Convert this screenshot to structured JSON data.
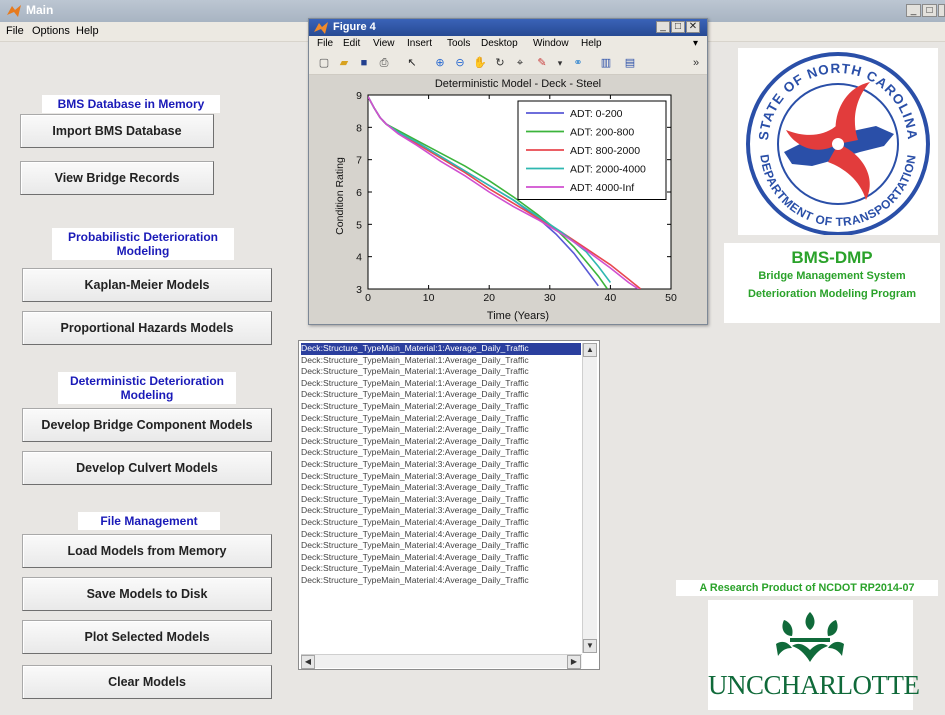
{
  "main_window": {
    "title": "Main",
    "menu": [
      "File",
      "Options",
      "Help"
    ]
  },
  "left_panel": {
    "bms_database_label": "BMS Database in Memory",
    "import_button": "Import BMS Database",
    "view_records_button": "View Bridge Records",
    "probabilistic_label_line1": "Probabilistic Deterioration",
    "probabilistic_label_line2": "Modeling",
    "kaplan_meier_button": "Kaplan-Meier Models",
    "proportional_hazards_button": "Proportional Hazards Models",
    "deterministic_label_line1": "Deterministic Deterioration",
    "deterministic_label_line2": "Modeling",
    "bridge_component_button": "Develop Bridge Component Models",
    "culvert_button": "Develop Culvert Models",
    "file_management_label": "File Management",
    "load_button": "Load Models from Memory",
    "save_button": "Save Models to Disk",
    "plot_button": "Plot Selected Models",
    "clear_button": "Clear Models"
  },
  "figure_window": {
    "title": "Figure 4",
    "menu": [
      "File",
      "Edit",
      "View",
      "Insert",
      "Tools",
      "Desktop",
      "Window",
      "Help"
    ],
    "toolbar_icons": [
      "new-file-icon",
      "open-folder-icon",
      "save-icon",
      "print-icon",
      "pointer-icon",
      "zoom-in-icon",
      "zoom-out-icon",
      "pan-icon",
      "rotate-icon",
      "data-cursor-icon",
      "brush-icon",
      "link-icon",
      "colorbar-icon",
      "legend-icon"
    ]
  },
  "chart_data": {
    "type": "line",
    "title": "Deterministic Model - Deck - Steel",
    "xlabel": "Time (Years)",
    "ylabel": "Condition Rating",
    "xlim": [
      0,
      50
    ],
    "ylim": [
      3,
      9
    ],
    "xticks": [
      0,
      10,
      20,
      30,
      40,
      50
    ],
    "yticks": [
      3,
      4,
      5,
      6,
      7,
      8,
      9
    ],
    "grid": false,
    "legend_position": "top-right",
    "series": [
      {
        "name": "ADT: 0-200",
        "color": "#5a5ad6",
        "x": [
          0,
          1,
          2,
          3,
          5,
          8,
          12,
          16,
          20,
          24,
          28,
          31,
          34,
          36,
          38
        ],
        "y": [
          8.95,
          8.6,
          8.3,
          8.1,
          7.85,
          7.55,
          7.1,
          6.65,
          6.2,
          5.75,
          5.2,
          4.7,
          4.1,
          3.6,
          3.1
        ]
      },
      {
        "name": "ADT: 200-800",
        "color": "#3cb43c",
        "x": [
          0,
          1,
          2,
          3,
          5,
          8,
          12,
          16,
          20,
          24,
          28,
          31,
          34,
          36,
          38,
          39.5
        ],
        "y": [
          8.95,
          8.6,
          8.3,
          8.1,
          7.9,
          7.6,
          7.2,
          6.8,
          6.35,
          5.85,
          5.3,
          4.85,
          4.3,
          3.85,
          3.4,
          3.0
        ]
      },
      {
        "name": "ADT: 800-2000",
        "color": "#e8484f",
        "x": [
          0,
          1,
          2,
          3,
          5,
          8,
          12,
          16,
          20,
          24,
          28,
          32,
          36,
          40,
          43,
          45
        ],
        "y": [
          8.95,
          8.6,
          8.3,
          8.1,
          7.85,
          7.5,
          7.05,
          6.6,
          6.1,
          5.65,
          5.2,
          4.75,
          4.25,
          3.75,
          3.3,
          3.0
        ]
      },
      {
        "name": "ADT: 2000-4000",
        "color": "#2fb8b0",
        "x": [
          0,
          1,
          2,
          3,
          5,
          8,
          12,
          16,
          20,
          24,
          28,
          32,
          36,
          38,
          40
        ],
        "y": [
          8.95,
          8.6,
          8.3,
          8.1,
          7.85,
          7.55,
          7.1,
          6.65,
          6.2,
          5.75,
          5.25,
          4.75,
          4.15,
          3.7,
          3.2
        ]
      },
      {
        "name": "ADT: 4000-Inf",
        "color": "#d04fd0",
        "x": [
          0,
          1,
          2,
          3,
          5,
          8,
          12,
          16,
          20,
          24,
          28,
          32,
          36,
          40,
          43,
          45
        ],
        "y": [
          8.95,
          8.6,
          8.3,
          8.1,
          7.8,
          7.45,
          6.95,
          6.5,
          6.0,
          5.55,
          5.15,
          4.7,
          4.2,
          3.65,
          3.2,
          2.95
        ]
      }
    ]
  },
  "listbox": {
    "items": [
      "Deck:Structure_TypeMain_Material:1:Average_Daily_Traffic",
      "Deck:Structure_TypeMain_Material:1:Average_Daily_Traffic",
      "Deck:Structure_TypeMain_Material:1:Average_Daily_Traffic",
      "Deck:Structure_TypeMain_Material:1:Average_Daily_Traffic",
      "Deck:Structure_TypeMain_Material:1:Average_Daily_Traffic",
      "Deck:Structure_TypeMain_Material:2:Average_Daily_Traffic",
      "Deck:Structure_TypeMain_Material:2:Average_Daily_Traffic",
      "Deck:Structure_TypeMain_Material:2:Average_Daily_Traffic",
      "Deck:Structure_TypeMain_Material:2:Average_Daily_Traffic",
      "Deck:Structure_TypeMain_Material:2:Average_Daily_Traffic",
      "Deck:Structure_TypeMain_Material:3:Average_Daily_Traffic",
      "Deck:Structure_TypeMain_Material:3:Average_Daily_Traffic",
      "Deck:Structure_TypeMain_Material:3:Average_Daily_Traffic",
      "Deck:Structure_TypeMain_Material:3:Average_Daily_Traffic",
      "Deck:Structure_TypeMain_Material:3:Average_Daily_Traffic",
      "Deck:Structure_TypeMain_Material:4:Average_Daily_Traffic",
      "Deck:Structure_TypeMain_Material:4:Average_Daily_Traffic",
      "Deck:Structure_TypeMain_Material:4:Average_Daily_Traffic",
      "Deck:Structure_TypeMain_Material:4:Average_Daily_Traffic",
      "Deck:Structure_TypeMain_Material:4:Average_Daily_Traffic",
      "Deck:Structure_TypeMain_Material:4:Average_Daily_Traffic"
    ],
    "selected_index": 0
  },
  "right_panel": {
    "seal_top_text": "STATE OF NORTH CAROLINA",
    "seal_bottom_text": "DEPARTMENT OF TRANSPORTATION",
    "app_title": "BMS-DMP",
    "app_subtitle_line1": "Bridge Management System",
    "app_subtitle_line2": "Deterioration Modeling Program",
    "research_label": "A Research Product of NCDOT RP2014-07",
    "university_name": "UNCCHARLOTTE"
  },
  "colors": {
    "section_label_text": "#1a1ab8",
    "brand_green": "#2aa22a",
    "seal_blue": "#2a4fa8",
    "seal_red": "#e23c3c",
    "unc_green": "#106a3a"
  }
}
